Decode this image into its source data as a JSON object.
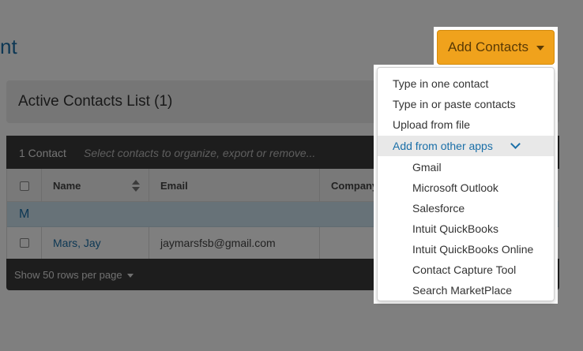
{
  "page": {
    "title_fragment": "nt"
  },
  "list_panel": {
    "title": "Active Contacts List (1)"
  },
  "toolbar": {
    "count": "1 Contact",
    "hint": "Select contacts to organize, export or remove..."
  },
  "table": {
    "headers": {
      "name": "Name",
      "email": "Email",
      "company": "Company"
    },
    "group_letter": "M",
    "rows": [
      {
        "name": "Mars, Jay",
        "email": "jaymarsfsb@gmail.com"
      }
    ]
  },
  "footer": {
    "rows_per_page": "Show 50 rows per page"
  },
  "add_contacts": {
    "label": "Add Contacts",
    "color": "#f0a21c"
  },
  "menu": {
    "items": [
      {
        "label": "Type in one contact"
      },
      {
        "label": "Type in or paste contacts"
      },
      {
        "label": "Upload from file"
      },
      {
        "label": "Add from other apps",
        "expanded": true
      }
    ],
    "subitems": [
      {
        "label": "Gmail"
      },
      {
        "label": "Microsoft Outlook"
      },
      {
        "label": "Salesforce"
      },
      {
        "label": "Intuit QuickBooks"
      },
      {
        "label": "Intuit QuickBooks Online"
      },
      {
        "label": "Contact Capture Tool"
      },
      {
        "label": "Search MarketPlace"
      }
    ]
  },
  "colors": {
    "link": "#1a6fa8",
    "group_row": "#cfe4f0",
    "toolbar": "#3a3a3a"
  }
}
